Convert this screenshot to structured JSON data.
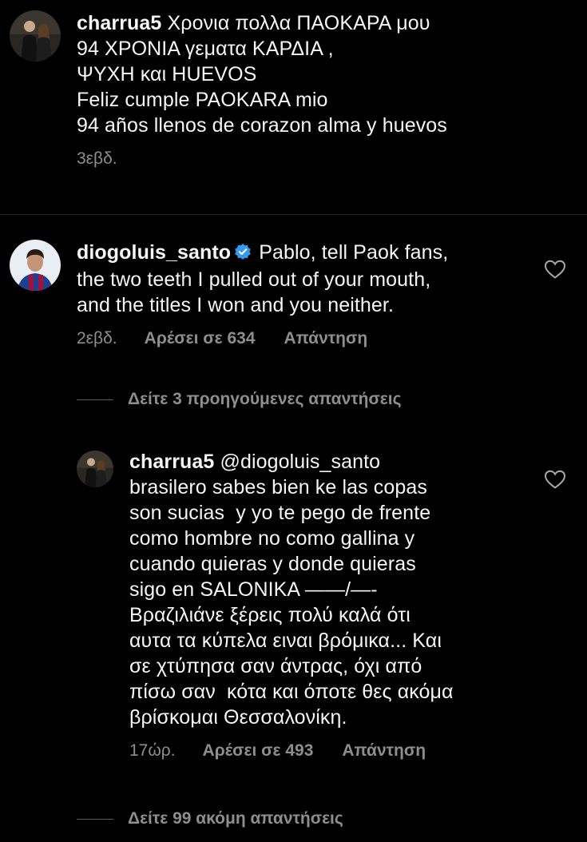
{
  "comments": [
    {
      "username": "charrua5",
      "text": " Χρονια πολλα ΠΑΟΚΑΡΑ μου\n94 ΧΡΟΝΙΑ γεματα ΚΑΡΔΙΑ ,\nΨΥΧΗ και HUEVOS\nFeliz cumple PAOKARA mio\n94 años llenos de corazon alma y huevos",
      "time": "3εβδ."
    },
    {
      "username": "diogoluis_santo",
      "verified": true,
      "text": " Pablo, tell Paok fans,\nthe two teeth I pulled out of your mouth,\nand the titles I won and you neither.",
      "time": "2εβδ.",
      "likes": "Αρέσει σε 634",
      "reply": "Απάντηση",
      "view_previous": "Δείτε 3 προηγούμενες απαντήσεις"
    },
    {
      "username": "charrua5",
      "text": " @diogoluis_santo\nbrasilero sabes bien ke las copas\nson sucias  y yo te pego de frente\ncomo hombre no como gallina y\ncuando quieras y donde quieras\nsigo en SALONIKA ——/—-\nΒραζιλιάνε ξέρεις πολύ καλά ότι\nαυτα τα κύπελα ειναι βρόμικα... Και\nσε χτύπησα σαν άντρας, όχι από\nπίσω σαν  κότα και όποτε θες ακόμα\nβρίσκομαι Θεσσαλονίκη.",
      "time": "17ώρ.",
      "likes": "Αρέσει σε 493",
      "reply": "Απάντηση",
      "view_more": "Δείτε 99 ακόμη απαντήσεις"
    }
  ],
  "colors": {
    "background": "#000000",
    "text": "#f5f5f5",
    "secondary": "#8e8e8e",
    "verified": "#3897f0"
  }
}
